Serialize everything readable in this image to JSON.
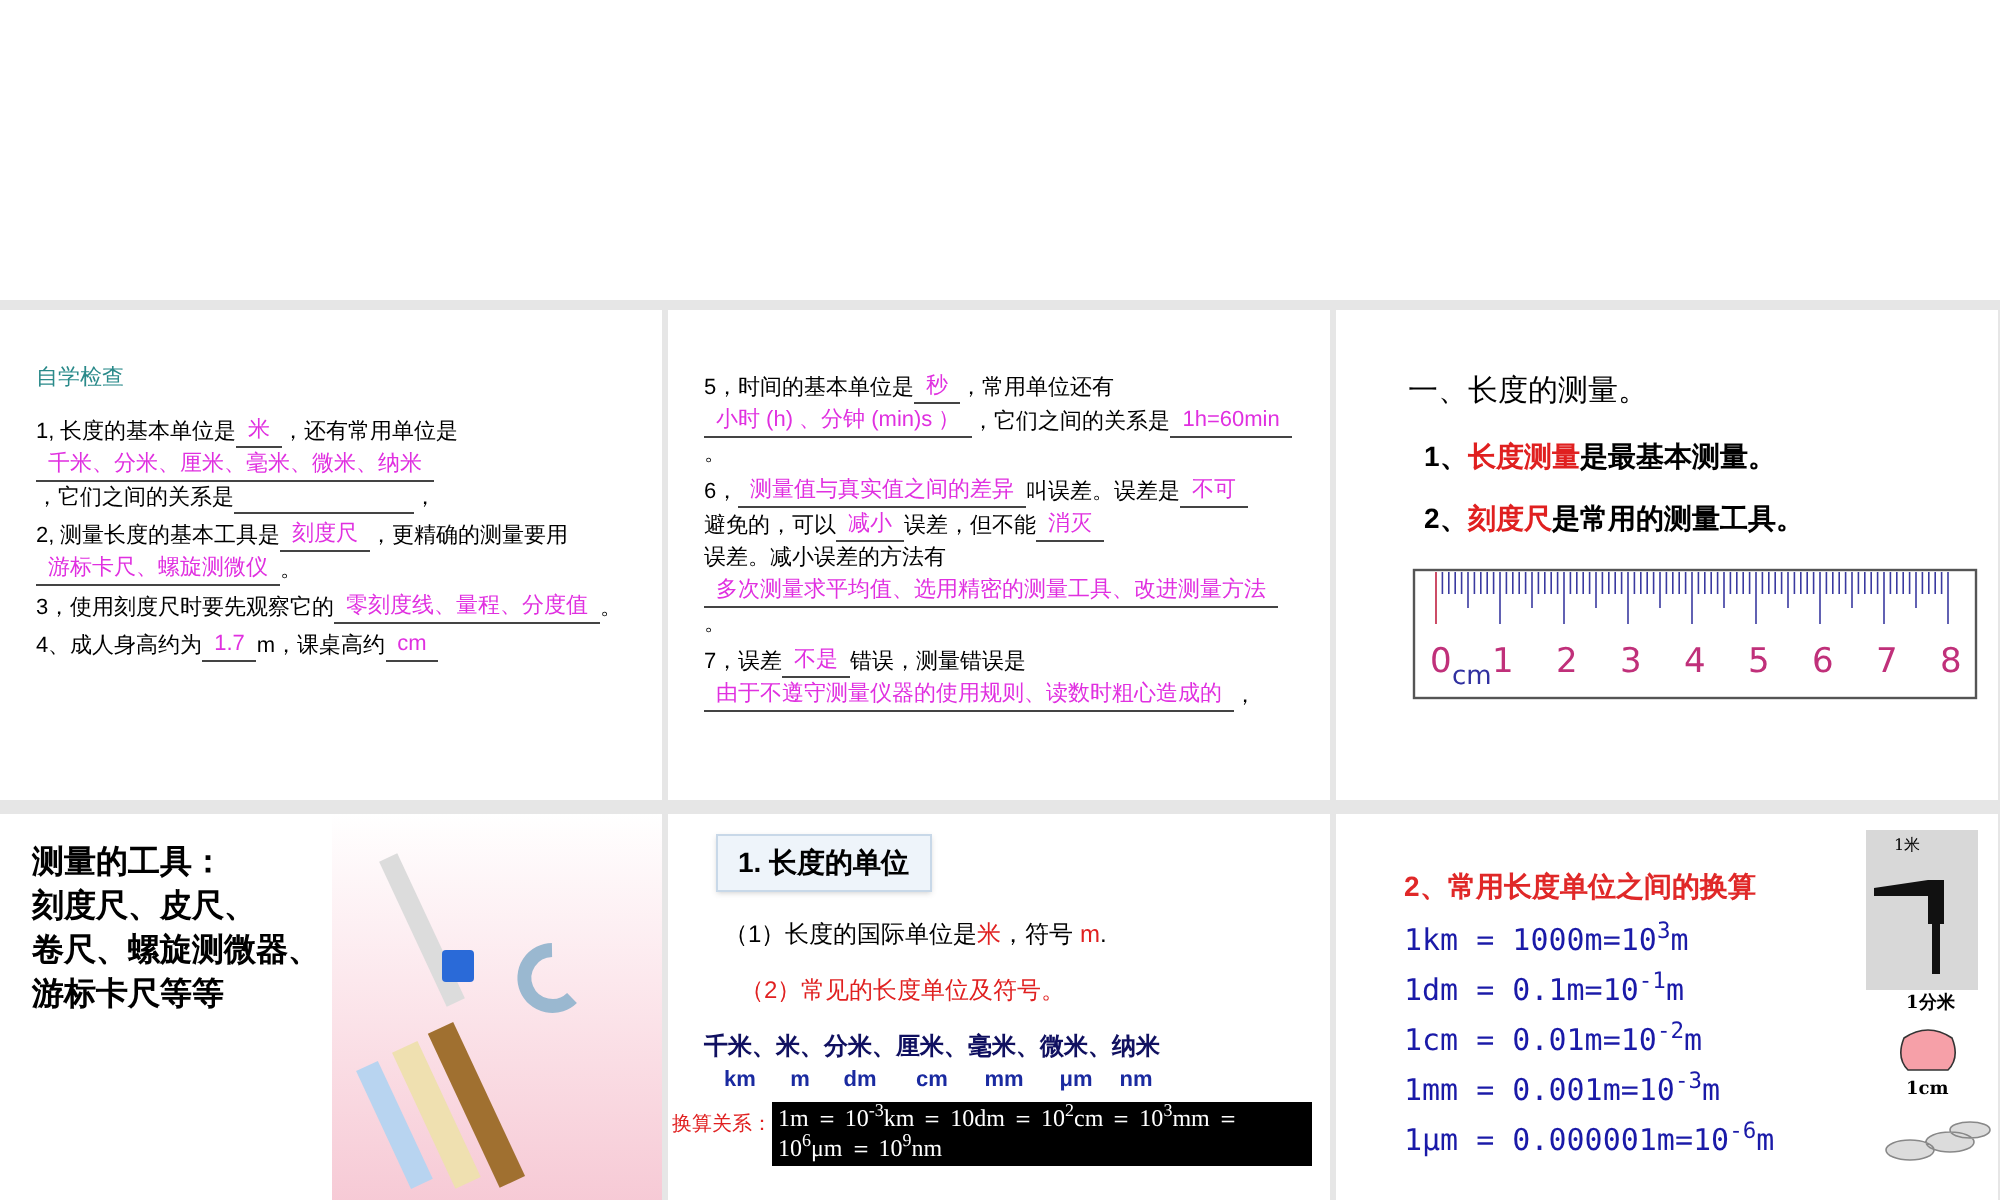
{
  "slides": [
    {
      "kind": "quiz",
      "heading": "自学检查",
      "questions": [
        {
          "parts": [
            {
              "kind": "text",
              "text": "1, 长度的基本单位是"
            },
            {
              "kind": "blank",
              "text": "米"
            },
            {
              "kind": "text",
              "text": "，还有常用单位是"
            },
            {
              "kind": "blank",
              "text": "千米、分米、厘米、毫米、微米、纳米"
            },
            {
              "kind": "text",
              "text": "，它们之间的关系是"
            },
            {
              "kind": "blank"
            },
            {
              "kind": "text",
              "text": "，"
            }
          ]
        },
        {
          "parts": [
            {
              "kind": "text",
              "text": "2, 测量长度的基本工具是"
            },
            {
              "kind": "blank",
              "text": "刻度尺"
            },
            {
              "kind": "text",
              "text": "，更精确的测量要用"
            },
            {
              "kind": "blank",
              "text": "游标卡尺、螺旋测微仪"
            },
            {
              "kind": "text",
              "text": "。"
            }
          ]
        },
        {
          "parts": [
            {
              "kind": "text",
              "text": "3，使用刻度尺时要先观察它的"
            },
            {
              "kind": "blank",
              "text": "零刻度线、量程、分度值"
            },
            {
              "kind": "text",
              "text": "。"
            }
          ]
        },
        {
          "parts": [
            {
              "kind": "text",
              "text": "4、成人身高约为"
            },
            {
              "kind": "blank",
              "text": "1.7"
            },
            {
              "kind": "text",
              "text": "m，课桌高约"
            },
            {
              "kind": "blank",
              "text": "cm"
            }
          ]
        }
      ]
    },
    {
      "kind": "quiz",
      "questions": [
        {
          "parts": [
            {
              "kind": "text",
              "text": "5，时间的基本单位是"
            },
            {
              "kind": "blank",
              "text": "秒"
            },
            {
              "kind": "text",
              "text": "，常用单位还有"
            },
            {
              "kind": "blank",
              "text": "小时 (h) 、分钟 (min)s ）"
            },
            {
              "kind": "text",
              "text": "，它们之间的关系是"
            },
            {
              "kind": "blank",
              "text": "1h=60min"
            },
            {
              "kind": "text",
              "text": "。"
            }
          ]
        },
        {
          "parts": [
            {
              "kind": "text",
              "text": "6，"
            },
            {
              "kind": "blank",
              "text": "测量值与真实值之间的差异"
            },
            {
              "kind": "text",
              "text": "叫误差。误差是"
            },
            {
              "kind": "blank",
              "text": "不可"
            },
            {
              "kind": "text",
              "text": "避免的，可以"
            },
            {
              "kind": "blank",
              "text": "减小"
            },
            {
              "kind": "text",
              "text": "误差，但不能"
            },
            {
              "kind": "blank",
              "text": "消灭"
            },
            {
              "kind": "text",
              "text": "误差。减小误差的方法有"
            },
            {
              "kind": "blank",
              "text": "多次测量求平均值、选用精密的测量工具、改进测量方法"
            },
            {
              "kind": "text",
              "text": "。"
            }
          ]
        },
        {
          "parts": [
            {
              "kind": "text",
              "text": "7，误差"
            },
            {
              "kind": "blank",
              "text": "不是"
            },
            {
              "kind": "text",
              "text": "错误，测量错误是"
            },
            {
              "kind": "blank",
              "text": "由于不遵守测量仪器的使用规则、读数时粗心造成的"
            },
            {
              "kind": "text",
              "text": "，"
            }
          ]
        }
      ]
    },
    {
      "kind": "ruler",
      "title": "一、长度的测量。",
      "points": [
        {
          "parts": [
            {
              "text": "1、",
              "emphasis": false
            },
            {
              "text": "长度测量",
              "emphasis": true
            },
            {
              "text": "是最基本测量。",
              "emphasis": false
            }
          ]
        },
        {
          "parts": [
            {
              "text": "2、",
              "emphasis": false
            },
            {
              "text": "刻度尺",
              "emphasis": true
            },
            {
              "text": "是常用的测量工具。",
              "emphasis": false
            }
          ]
        }
      ],
      "ruler": {
        "unit": "cm",
        "labels": [
          "0",
          "1",
          "2",
          "3",
          "4",
          "5",
          "6",
          "7",
          "8"
        ]
      }
    },
    {
      "kind": "tools",
      "lines": [
        "测量的工具：",
        "刻度尺、皮尺、",
        "卷尺、螺旋测微器、",
        "游标卡尺等等"
      ]
    },
    {
      "kind": "units",
      "title": "1. 长度的单位",
      "statement": [
        {
          "text": "（1）长度的国际单位是",
          "emphasis": false
        },
        {
          "text": "米",
          "emphasis": true
        },
        {
          "text": "，符号 ",
          "emphasis": false
        },
        {
          "text": "m",
          "emphasis": true
        },
        {
          "text": ".",
          "emphasis": false
        }
      ],
      "subtitle": "（2）常见的长度单位及符号。",
      "units": [
        {
          "name": "千米、",
          "symbol": "km"
        },
        {
          "name": "米、",
          "symbol": "m"
        },
        {
          "name": "分米、",
          "symbol": "dm"
        },
        {
          "name": "厘米、",
          "symbol": "cm"
        },
        {
          "name": "毫米、",
          "symbol": "mm"
        },
        {
          "name": "微米、",
          "symbol": "μm"
        },
        {
          "name": "纳米",
          "symbol": "nm"
        }
      ],
      "conversion_label": "换算关系：",
      "conversion": "1m ＝ 10$^{-3}$km ＝ 10dm ＝ 10$^{2}$cm ＝ 10$^{3}$mm ＝ 10$^{6}$μm ＝ 10$^{9}$nm"
    },
    {
      "kind": "conversions",
      "title": "2、常用长度单位之间的换算",
      "equations": [
        "1km = 1000m=10$^{3}$m",
        "1dm = 0.1m=10$^{-1}$m",
        "1cm = 0.01m=10$^{-2}$m",
        "1mm = 0.001m=10$^{-3}$m",
        "1μm = 0.000001m=10$^{-6}$m"
      ],
      "figure_labels": [
        "1米",
        "1分米",
        "1cm"
      ]
    }
  ]
}
